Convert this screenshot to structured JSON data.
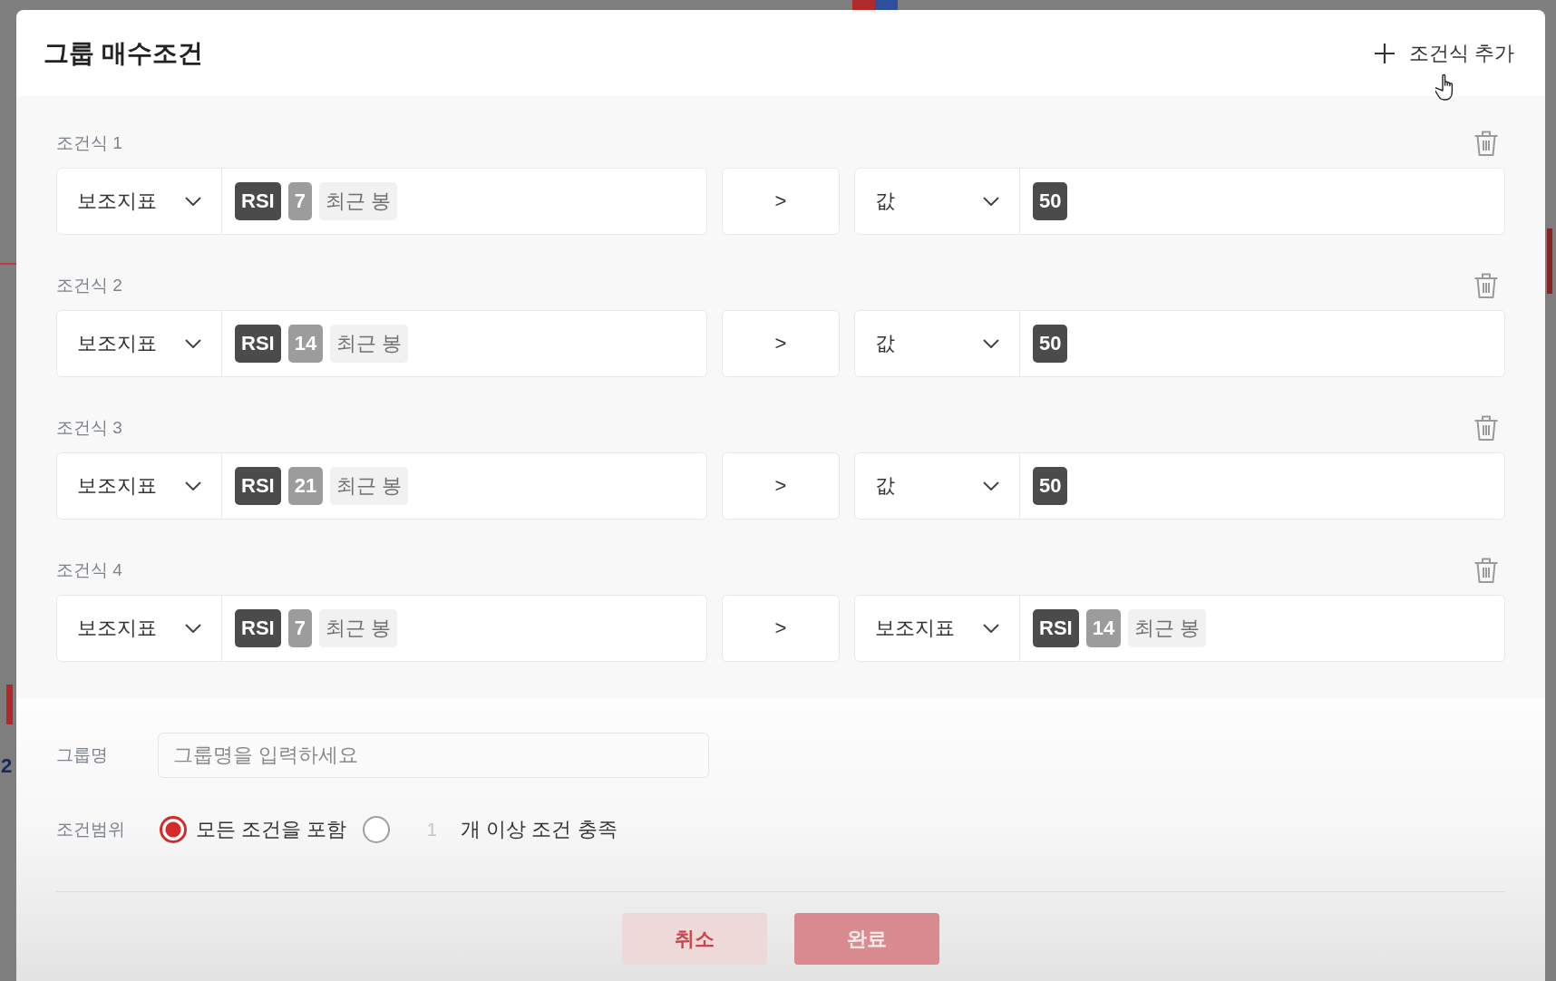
{
  "background": {
    "axis_label": "2"
  },
  "dialog": {
    "title": "그룹 매수조건",
    "add_button": {
      "label": "조건식 추가"
    }
  },
  "conditions": [
    {
      "label": "조건식 1",
      "left": {
        "type_label": "보조지표",
        "tokens": [
          {
            "kind": "indicator",
            "text": "RSI"
          },
          {
            "kind": "param",
            "text": "7"
          },
          {
            "kind": "period",
            "text": "최근 봉"
          }
        ]
      },
      "operator": ">",
      "right": {
        "type_label": "값",
        "tokens": [
          {
            "kind": "value",
            "text": "50"
          }
        ]
      }
    },
    {
      "label": "조건식 2",
      "left": {
        "type_label": "보조지표",
        "tokens": [
          {
            "kind": "indicator",
            "text": "RSI"
          },
          {
            "kind": "param",
            "text": "14"
          },
          {
            "kind": "period",
            "text": "최근 봉"
          }
        ]
      },
      "operator": ">",
      "right": {
        "type_label": "값",
        "tokens": [
          {
            "kind": "value",
            "text": "50"
          }
        ]
      }
    },
    {
      "label": "조건식 3",
      "left": {
        "type_label": "보조지표",
        "tokens": [
          {
            "kind": "indicator",
            "text": "RSI"
          },
          {
            "kind": "param",
            "text": "21"
          },
          {
            "kind": "period",
            "text": "최근 봉"
          }
        ]
      },
      "operator": ">",
      "right": {
        "type_label": "값",
        "tokens": [
          {
            "kind": "value",
            "text": "50"
          }
        ]
      }
    },
    {
      "label": "조건식 4",
      "left": {
        "type_label": "보조지표",
        "tokens": [
          {
            "kind": "indicator",
            "text": "RSI"
          },
          {
            "kind": "param",
            "text": "7"
          },
          {
            "kind": "period",
            "text": "최근 봉"
          }
        ]
      },
      "operator": ">",
      "right": {
        "type_label": "보조지표",
        "tokens": [
          {
            "kind": "indicator",
            "text": "RSI"
          },
          {
            "kind": "param",
            "text": "14"
          },
          {
            "kind": "period",
            "text": "최근 봉"
          }
        ]
      }
    }
  ],
  "group_name": {
    "label": "그룹명",
    "placeholder": "그룹명을 입력하세요"
  },
  "scope": {
    "label": "조건범위",
    "options": [
      {
        "kind": "all",
        "label": "모든 조건을 포함",
        "selected": true
      },
      {
        "kind": "count",
        "count": "1",
        "label": "개 이상 조건 충족",
        "selected": false
      }
    ]
  },
  "buttons": [
    {
      "kind": "cancel",
      "label": "취소"
    },
    {
      "kind": "confirm",
      "label": "완료"
    }
  ]
}
